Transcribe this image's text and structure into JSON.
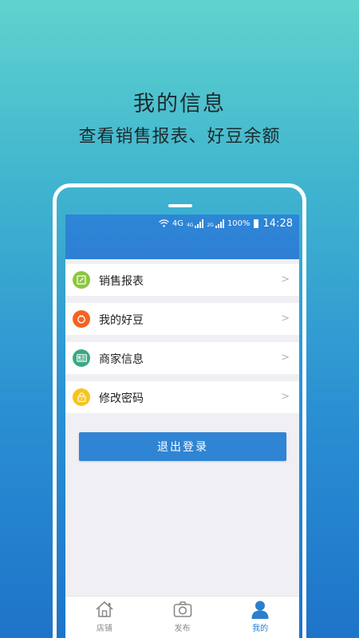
{
  "promo": {
    "title": "我的信息",
    "subtitle": "查看销售报表、好豆余额"
  },
  "status_bar": {
    "network_label": "4G",
    "network_small": "4G",
    "network_small2": "2G",
    "battery_percent": "100%",
    "time": "14:28"
  },
  "menu": {
    "items": [
      {
        "label": "销售报表",
        "icon": "edit-icon",
        "color": "#8cc63f"
      },
      {
        "label": "我的好豆",
        "icon": "bean-icon",
        "color": "#f26522"
      },
      {
        "label": "商家信息",
        "icon": "id-card-icon",
        "color": "#3aa982"
      },
      {
        "label": "修改密码",
        "icon": "lock-icon",
        "color": "#f7c41f"
      }
    ],
    "chevron": ">"
  },
  "logout_label": "退出登录",
  "tabs": [
    {
      "label": "店铺",
      "icon": "store-icon",
      "active": false
    },
    {
      "label": "发布",
      "icon": "camera-icon",
      "active": false
    },
    {
      "label": "我的",
      "icon": "user-icon",
      "active": true
    }
  ],
  "colors": {
    "accent": "#2f84d4",
    "inactive_tab": "#888888",
    "active_tab": "#2a7fce"
  }
}
